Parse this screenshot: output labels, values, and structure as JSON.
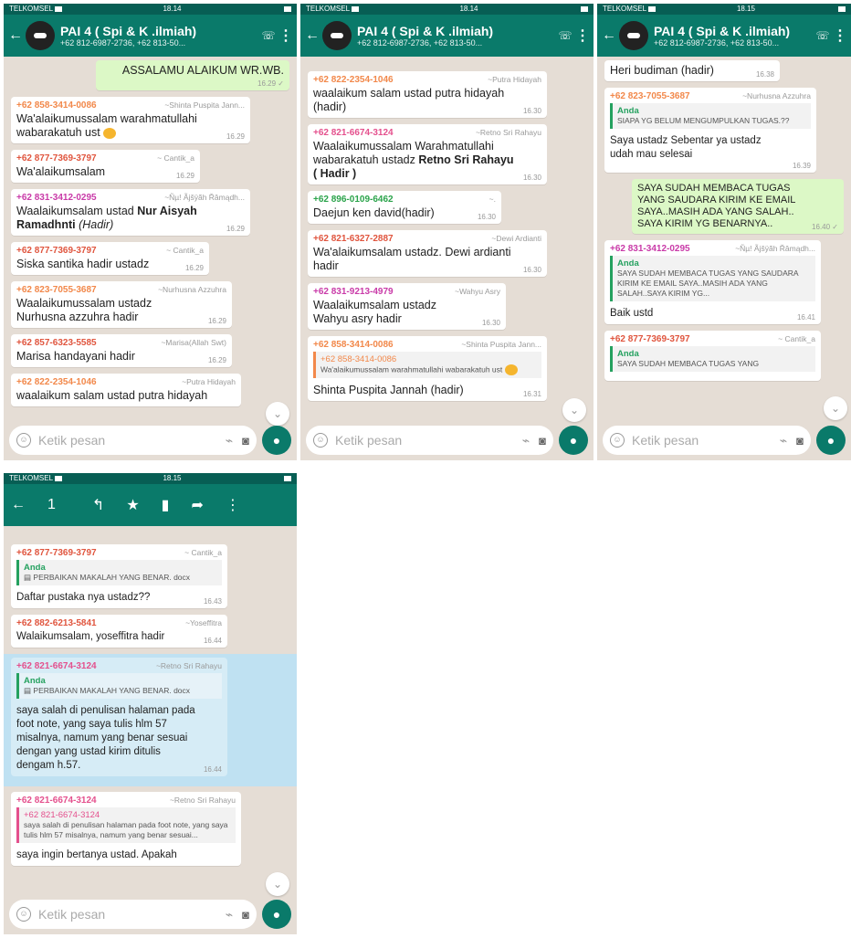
{
  "status": {
    "carrier": "TELKOMSEL",
    "times": [
      "18.14",
      "18.14",
      "18.15",
      "18.15"
    ]
  },
  "header": {
    "title": "PAI 4 ( Spi & K .ilmiah)",
    "subtitle": "+62 812-6987-2736, +62 813-50..."
  },
  "selection": {
    "count": "1"
  },
  "input": {
    "placeholder": "Ketik pesan"
  },
  "colors": {
    "header": "#0a7a6a",
    "chat_bg": "#e5ddd5",
    "outgoing": "#dcf8c6",
    "selected": "#bfe1f2"
  },
  "screen1": {
    "out1": {
      "text": "ASSALAMU ALAIKUM WR.WB.",
      "time": "16.29 ✓"
    },
    "m1": {
      "phone": "+62 858-3414-0086",
      "nick": "~Shinta Puspita Jann...",
      "text": "Wa'alaikumussalam warahmatullahi wabarakatuh ust",
      "time": "16.29"
    },
    "m2": {
      "phone": "+62 877-7369-3797",
      "nick": "~ Cantik_a",
      "text": "Wa'alaikumsalam",
      "time": "16.29"
    },
    "m3": {
      "phone": "+62 831-3412-0295",
      "nick": "~Ñµ! Ãjšÿãh Řâmądh...",
      "text_a": "Waalaikumsalam ustad ",
      "text_b": "Nur Aisyah Ramadhnti",
      "text_c": " (Hadir)",
      "time": "16.29"
    },
    "m4": {
      "phone": "+62 877-7369-3797",
      "nick": "~ Cantik_a",
      "text": "Siska santika hadir ustadz",
      "time": "16.29"
    },
    "m5": {
      "phone": "+62 823-7055-3687",
      "nick": "~Nurhusna Azzuhra",
      "text": "Waalaikumussalam ustadz Nurhusna azzuhra hadir",
      "time": "16.29"
    },
    "m6": {
      "phone": "+62 857-6323-5585",
      "nick": "~Marisa(Allah Swt)",
      "text": "Marisa handayani hadir",
      "time": "16.29"
    },
    "m7": {
      "phone": "+62 822-2354-1046",
      "nick": "~Putra Hidayah",
      "text": "waalaikum salam ustad putra hidayah"
    }
  },
  "screen2": {
    "m1": {
      "phone": "+62 822-2354-1046",
      "nick": "~Putra Hidayah",
      "text": "waalaikum salam ustad putra hidayah (hadir)",
      "time": "16.30"
    },
    "m2": {
      "phone": "+62 821-6674-3124",
      "nick": "~Retno Sri Rahayu",
      "text_a": "Waalaikumussalam Warahmatullahi wabarakatuh ustadz ",
      "text_b": "Retno Sri Rahayu ( Hadir )",
      "time": "16.30"
    },
    "m3": {
      "phone": "+62 896-0109-6462",
      "nick": "~.",
      "text": "Daejun ken david(hadir)",
      "time": "16.30"
    },
    "m4": {
      "phone": "+62 821-6327-2887",
      "nick": "~Dewi Ardianti",
      "text": "Wa'alaikumsalam ustadz. Dewi ardianti hadir",
      "time": "16.30"
    },
    "m5": {
      "phone": "+62 831-9213-4979",
      "nick": "~Wahyu Asry",
      "text": "Waalaikumsalam ustadz Wahyu asry hadir",
      "time": "16.30"
    },
    "m6": {
      "phone": "+62 858-3414-0086",
      "nick": "~Shinta Puspita Jann...",
      "q_phone": "+62 858-3414-0086",
      "q_text": "Wa'alaikumussalam warahmatullahi wabarakatuh ust",
      "text": "Shinta Puspita Jannah (hadir)",
      "time": "16.31"
    }
  },
  "screen3": {
    "m0": {
      "text": "Heri budiman (hadir)",
      "time": "16.38"
    },
    "m1": {
      "phone": "+62 823-7055-3687",
      "nick": "~Nurhusna Azzuhra",
      "q_name": "Anda",
      "q_text": "SIAPA YG BELUM MENGUMPULKAN TUGAS.??",
      "text": "Saya ustadz Sebentar ya ustadz udah mau selesai",
      "time": "16.39"
    },
    "out1": {
      "text": "SAYA SUDAH MEMBACA TUGAS YANG SAUDARA KIRIM KE EMAIL SAYA..MASIH ADA YANG SALAH.. SAYA KIRIM YG BENARNYA..",
      "time": "16.40 ✓"
    },
    "m2": {
      "phone": "+62 831-3412-0295",
      "nick": "~Ñµ! Ãjšÿãh Řâmądh...",
      "q_name": "Anda",
      "q_text": "SAYA SUDAH MEMBACA TUGAS YANG SAUDARA KIRIM KE EMAIL SAYA..MASIH ADA YANG SALAH..SAYA KIRIM YG...",
      "text": "Baik ustd",
      "time": "16.41"
    },
    "m3": {
      "phone": "+62 877-7369-3797",
      "nick": "~ Cantik_a",
      "q_name": "Anda",
      "q_text": "SAYA SUDAH MEMBACA TUGAS YANG"
    }
  },
  "screen4": {
    "m1": {
      "phone": "+62 877-7369-3797",
      "nick": "~ Cantik_a",
      "q_name": "Anda",
      "q_text": "PERBAIKAN MAKALAH YANG BENAR. docx",
      "text": "Daftar pustaka nya ustadz??",
      "time": "16.43"
    },
    "m2": {
      "phone": "+62 882-6213-5841",
      "nick": "~Yoseffitra",
      "text": "Walaikumsalam, yoseffitra hadir",
      "time": "16.44"
    },
    "m3": {
      "phone": "+62 821-6674-3124",
      "nick": "~Retno Sri Rahayu",
      "q_name": "Anda",
      "q_text": "PERBAIKAN MAKALAH YANG BENAR. docx",
      "text": "saya salah di penulisan halaman pada foot note, yang saya tulis hlm 57 misalnya, namum yang benar sesuai dengan yang ustad kirim ditulis dengam h.57.",
      "time": "16.44"
    },
    "m4": {
      "phone": "+62 821-6674-3124",
      "nick": "~Retno Sri Rahayu",
      "q_phone": "+62 821-6674-3124",
      "q_text": "saya salah di penulisan halaman pada foot note, yang saya tulis hlm 57 misalnya, namum yang benar sesuai...",
      "text": "saya ingin bertanya ustad. Apakah"
    }
  }
}
